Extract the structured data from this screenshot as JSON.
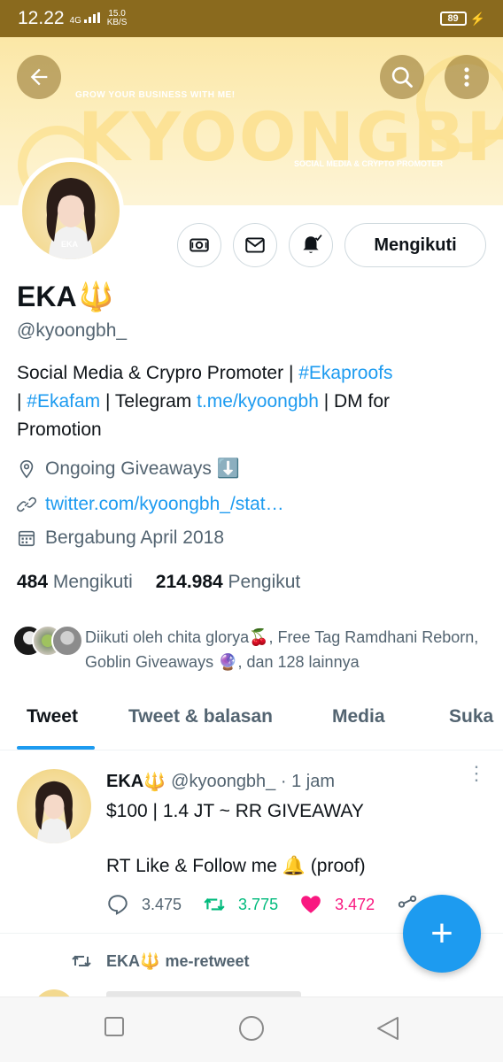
{
  "status_bar": {
    "time": "12.22",
    "network": "4G",
    "speed_value": "15.0",
    "speed_unit": "KB/S",
    "battery": "89"
  },
  "banner": {
    "tagline": "GROW YOUR BUSINESS WITH ME!",
    "big_text": "KYOONGBH",
    "subtitle": "SOCIAL MEDIA & CRYPTO PROMOTER"
  },
  "profile": {
    "name": "EKA",
    "name_emoji": "🔱",
    "handle": "@kyoongbh_",
    "avatar_label": "EKA",
    "follow_button": "Mengikuti",
    "bio": {
      "part1": "Social Media & Crypro Promoter | ",
      "tag1": "#Ekaproofs",
      "part2": " | ",
      "tag2": "#Ekafam",
      "part3": " | Telegram ",
      "link": "t.me/kyoongbh",
      "part4": " | DM for Promotion"
    },
    "location": "Ongoing Giveaways ⬇️",
    "website": "twitter.com/kyoongbh_/stat…",
    "joined": "Bergabung April 2018",
    "following_count": "484",
    "following_label": "Mengikuti",
    "followers_count": "214.984",
    "followers_label": "Pengikut",
    "followed_by": "Diikuti oleh chita glorya🍒, Free Tag Ramdhani Reborn, Goblin Giveaways 🔮, dan 128 lainnya"
  },
  "tabs": [
    {
      "label": "Tweet"
    },
    {
      "label": "Tweet & balasan"
    },
    {
      "label": "Media"
    },
    {
      "label": "Suka"
    }
  ],
  "tweet": {
    "name": "EKA",
    "name_emoji": "🔱",
    "handle": "@kyoongbh_",
    "time": "· 1 jam",
    "text": "$100 | 1.4 JT ~ RR GIVEAWAY\n\nRT Like & Follow me 🔔 (proof)",
    "replies": "3.475",
    "retweets": "3.775",
    "likes": "3.472"
  },
  "retweet_banner": {
    "name": "EKA",
    "name_emoji": "🔱",
    "label": "me-retweet"
  },
  "fab_symbol": "+",
  "colors": {
    "accent": "#1d9bf0",
    "retweet": "#00ba7c",
    "like": "#f91880",
    "status_bar": "#8a6a1e",
    "banner": "#fbe7a6"
  }
}
